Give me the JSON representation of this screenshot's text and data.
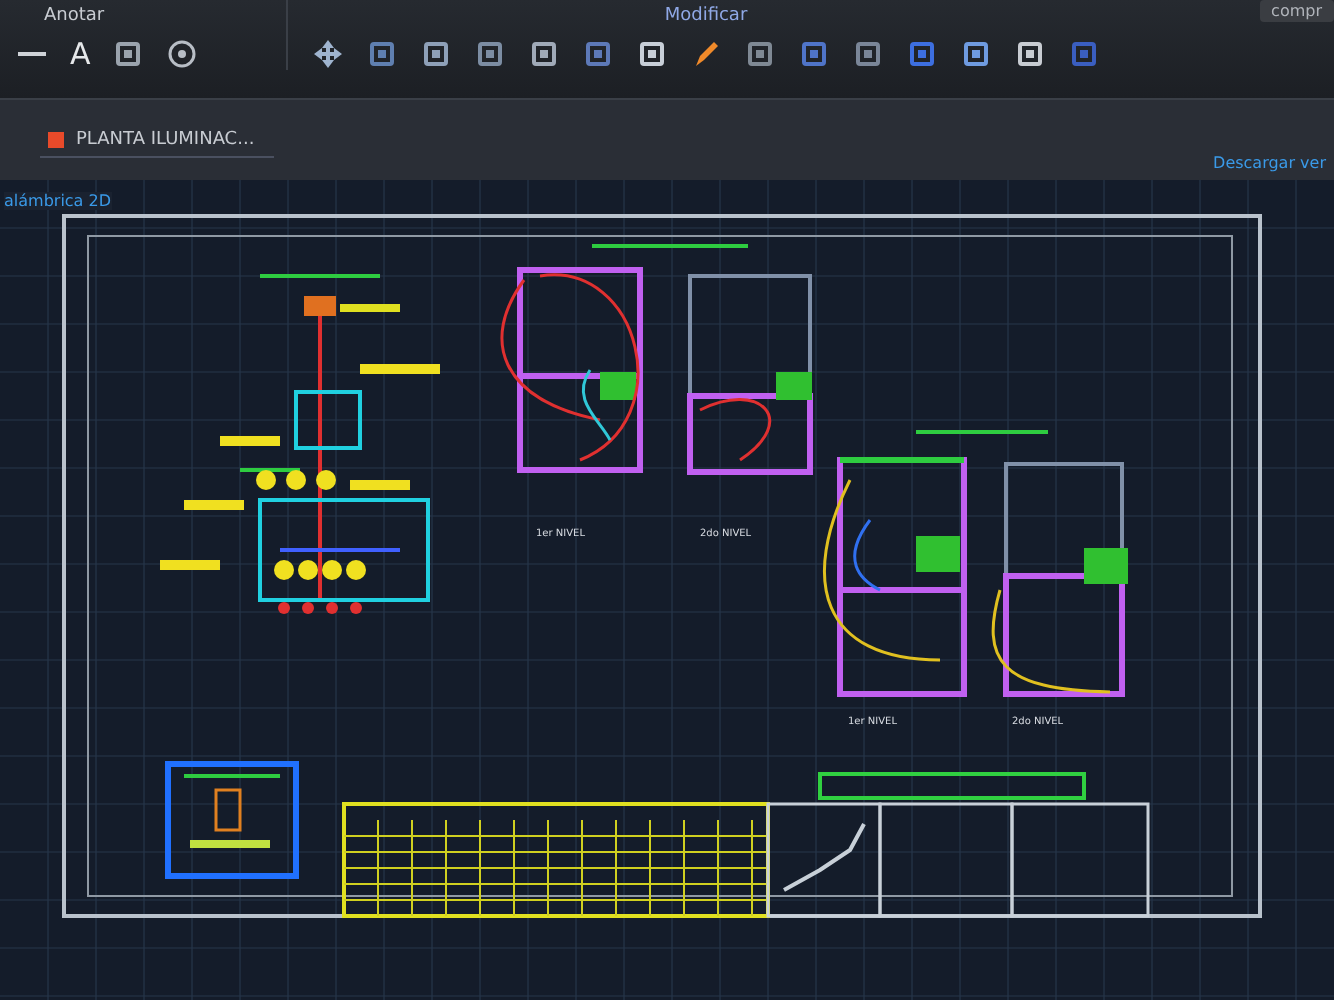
{
  "ribbon": {
    "panels": [
      {
        "label": "Anotar",
        "tools": [
          {
            "kind": "line"
          },
          {
            "kind": "text",
            "glyph": "A"
          },
          {
            "kind": "leader"
          },
          {
            "kind": "gear"
          }
        ]
      },
      {
        "label": "Modificar",
        "tools": [
          {
            "kind": "move"
          },
          {
            "kind": "copy"
          },
          {
            "kind": "mirror"
          },
          {
            "kind": "fillet"
          },
          {
            "kind": "array"
          },
          {
            "kind": "scale"
          },
          {
            "kind": "trim"
          },
          {
            "kind": "erase"
          },
          {
            "kind": "rotate"
          },
          {
            "kind": "stretch"
          },
          {
            "kind": "offset"
          },
          {
            "kind": "join"
          },
          {
            "kind": "properties"
          },
          {
            "kind": "explode"
          },
          {
            "kind": "block"
          }
        ]
      }
    ],
    "corner_text": "compr"
  },
  "file_tab": {
    "label": "PLANTA ILUMINAC..."
  },
  "download_link": "Descargar ver",
  "viewport_style": "alámbrica 2D",
  "drawing": {
    "lighting_plan_levels": [
      "1er NIVEL",
      "2do NIVEL"
    ],
    "outlet_plan_levels": [
      "1er NIVEL",
      "2do NIVEL"
    ]
  }
}
